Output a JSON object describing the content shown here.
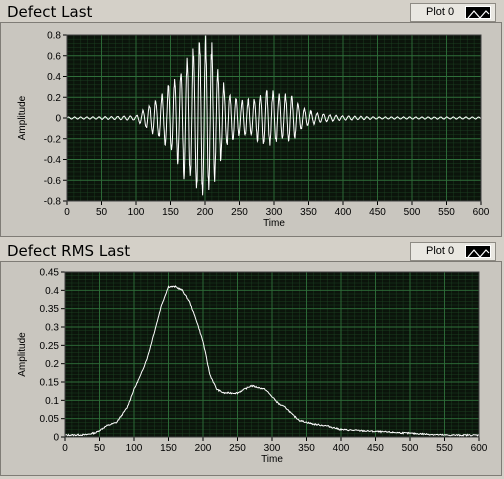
{
  "charts": [
    {
      "id": "top",
      "title": "Defect Last",
      "legend": {
        "label": "Plot 0"
      }
    },
    {
      "id": "bottom",
      "title": "Defect RMS Last",
      "legend": {
        "label": "Plot 0"
      }
    }
  ],
  "colors": {
    "plot_background": "#0b140b",
    "grid": "#2f6f3a",
    "trace": "#ffffff",
    "panel": "#d4d0c8"
  },
  "chart_data": [
    {
      "type": "line",
      "title": "Defect Last",
      "xlabel": "Time",
      "ylabel": "Amplitude",
      "xlim": [
        0,
        600
      ],
      "ylim": [
        -0.8,
        0.8
      ],
      "x_ticks": [
        "0",
        "50",
        "100",
        "150",
        "200",
        "250",
        "300",
        "350",
        "400",
        "450",
        "500",
        "550",
        "600"
      ],
      "y_ticks": [
        "0.8",
        "0.6",
        "0.4",
        "0.2",
        "0",
        "-0.2",
        "-0.4",
        "-0.6",
        "-0.8"
      ],
      "grid": true,
      "legend_position": "top-right",
      "series": [
        {
          "name": "Plot 0",
          "x": [
            0,
            40,
            100,
            110,
            120,
            130,
            140,
            150,
            160,
            170,
            180,
            190,
            200,
            210,
            220,
            230,
            240,
            250,
            260,
            270,
            280,
            290,
            300,
            310,
            320,
            330,
            340,
            350,
            360,
            380,
            400,
            450,
            500,
            550,
            600
          ],
          "envelope": [
            0.01,
            0.01,
            0.02,
            0.07,
            0.13,
            0.17,
            0.22,
            0.32,
            0.42,
            0.52,
            0.62,
            0.72,
            0.76,
            0.65,
            0.42,
            0.28,
            0.2,
            0.16,
            0.16,
            0.18,
            0.22,
            0.25,
            0.24,
            0.2,
            0.22,
            0.18,
            0.1,
            0.07,
            0.05,
            0.03,
            0.02,
            0.01,
            0.01,
            0.01,
            0.01
          ]
        }
      ]
    },
    {
      "type": "line",
      "title": "Defect RMS Last",
      "xlabel": "Time",
      "ylabel": "Amplitude",
      "xlim": [
        0,
        600
      ],
      "ylim": [
        0,
        0.45
      ],
      "x_ticks": [
        "0",
        "50",
        "100",
        "150",
        "200",
        "250",
        "300",
        "350",
        "400",
        "450",
        "500",
        "550",
        "600"
      ],
      "y_ticks": [
        "0.45",
        "0.4",
        "0.35",
        "0.3",
        "0.25",
        "0.2",
        "0.15",
        "0.1",
        "0.05",
        "0"
      ],
      "grid": true,
      "legend_position": "top-right",
      "series": [
        {
          "name": "Plot 0",
          "x": [
            0,
            30,
            45,
            60,
            75,
            90,
            100,
            110,
            120,
            130,
            140,
            150,
            160,
            170,
            180,
            190,
            200,
            210,
            220,
            230,
            240,
            250,
            260,
            270,
            280,
            290,
            300,
            310,
            320,
            330,
            340,
            360,
            380,
            400,
            450,
            500,
            550,
            600
          ],
          "y": [
            0.005,
            0.006,
            0.012,
            0.03,
            0.04,
            0.08,
            0.13,
            0.17,
            0.22,
            0.29,
            0.36,
            0.41,
            0.41,
            0.4,
            0.37,
            0.32,
            0.26,
            0.17,
            0.13,
            0.12,
            0.12,
            0.12,
            0.13,
            0.14,
            0.135,
            0.13,
            0.11,
            0.09,
            0.08,
            0.06,
            0.045,
            0.035,
            0.03,
            0.02,
            0.015,
            0.01,
            0.005,
            0.005
          ]
        }
      ]
    }
  ]
}
